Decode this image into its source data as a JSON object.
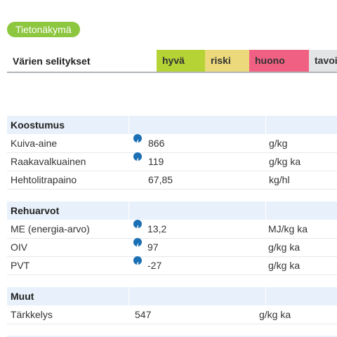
{
  "view_label": "Tietonäkymä",
  "legend": {
    "title": "Värien selitykset",
    "items": [
      {
        "label": "hyvä",
        "color": "#b5d334"
      },
      {
        "label": "riski",
        "color": "#ecd97b"
      },
      {
        "label": "huono",
        "color": "#f06082"
      },
      {
        "label": "tavoi",
        "color": "#e3e4e6"
      }
    ]
  },
  "sections": [
    {
      "title": "Koostumus",
      "rows": [
        {
          "name": "Kuiva-aine",
          "info": true,
          "value": "866",
          "unit": "g/kg"
        },
        {
          "name": "Raakavalkuainen",
          "info": true,
          "value": "119",
          "unit": "g/kg ka"
        },
        {
          "name": "Hehtolitrapaino",
          "info": false,
          "value": "67,85",
          "unit": "kg/hl"
        }
      ]
    },
    {
      "title": "Rehuarvot",
      "rows": [
        {
          "name": "ME (energia-arvo)",
          "info": true,
          "value": "13,2",
          "unit": "MJ/kg ka"
        },
        {
          "name": "OIV",
          "info": true,
          "value": "97",
          "unit": "g/kg ka"
        },
        {
          "name": "PVT",
          "info": true,
          "value": "-27",
          "unit": "g/kg ka"
        }
      ]
    },
    {
      "title": "Muut",
      "rows": [
        {
          "name": "Tärkkelys",
          "info": false,
          "value": "547",
          "unit": "g/kg ka"
        }
      ]
    }
  ]
}
